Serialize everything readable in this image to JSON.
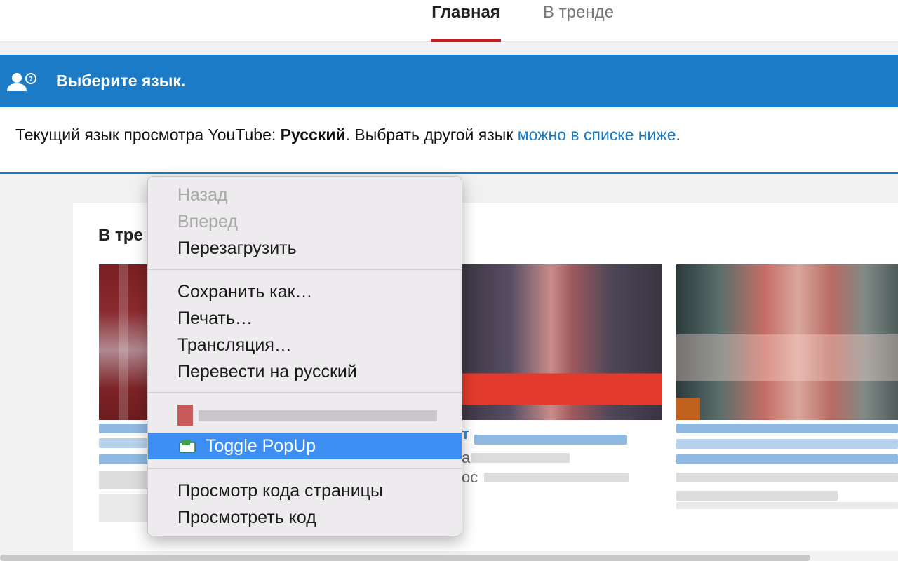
{
  "tabs": {
    "home": "Главная",
    "trending": "В тренде"
  },
  "language_banner": {
    "title": "Выберите язык.",
    "text_before": "Текущий язык просмотра YouTube: ",
    "current_language": "Русский",
    "text_middle": ". Выбрать другой язык ",
    "link_text": "можно в списке ниже",
    "text_end": "."
  },
  "trending": {
    "section_title_partial": "В тре",
    "video2_title_partial": "т",
    "video2_meta_partial_1": "а",
    "video2_meta_partial_2": "ос"
  },
  "context_menu": {
    "items": [
      {
        "label": "Назад",
        "enabled": false
      },
      {
        "label": "Вперед",
        "enabled": false
      },
      {
        "label": "Перезагрузить",
        "enabled": true
      },
      {
        "label": "Сохранить как…",
        "enabled": true
      },
      {
        "label": "Печать…",
        "enabled": true
      },
      {
        "label": "Трансляция…",
        "enabled": true
      },
      {
        "label": "Перевести на русский",
        "enabled": true
      },
      {
        "label": "Toggle PopUp",
        "enabled": true,
        "highlighted": true
      },
      {
        "label": "Просмотр кода страницы",
        "enabled": true
      },
      {
        "label": "Просмотреть код",
        "enabled": true
      }
    ]
  },
  "colors": {
    "banner_blue": "#1b7bc7",
    "active_tab_underline": "#cc181e",
    "link_blue": "#167ac6",
    "menu_highlight": "#3d8ef2"
  }
}
